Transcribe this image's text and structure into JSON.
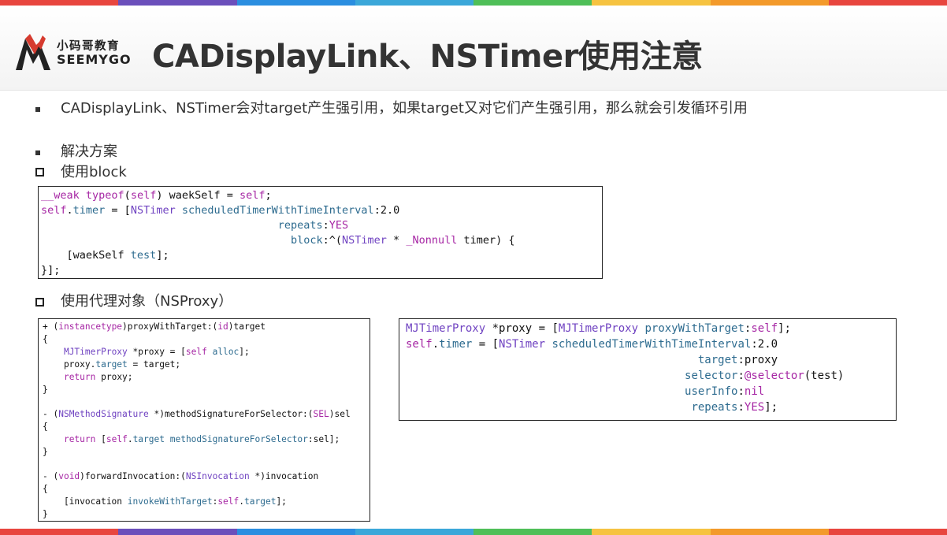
{
  "colors": {
    "stripe": [
      "#e8463f",
      "#6b4fbb",
      "#2b8ee0",
      "#3ba7d9",
      "#4fbf58",
      "#f6c341",
      "#f39a2b",
      "#e8463f"
    ],
    "keyword": "#a626a4",
    "type": "#6f42c1",
    "method": "#2d6b8f"
  },
  "header": {
    "logo_cn": "小码哥教育",
    "logo_en": "SEEMYGO",
    "title": "CADisplayLink、NSTimer使用注意"
  },
  "body": {
    "point1": "CADisplayLink、NSTimer会对target产生强引用，如果target又对它们产生强引用，那么就会引发循环引用",
    "point2": "解决方案",
    "sub1": "使用block",
    "sub2": "使用代理对象（NSProxy）"
  },
  "code_block": [
    [
      {
        "t": "__weak typeof",
        "c": "kw"
      },
      {
        "t": "("
      },
      {
        "t": "self",
        "c": "kw"
      },
      {
        "t": ") waekSelf = "
      },
      {
        "t": "self",
        "c": "kw"
      },
      {
        "t": ";"
      }
    ],
    [
      {
        "t": "self",
        "c": "kw"
      },
      {
        "t": "."
      },
      {
        "t": "timer",
        "c": "mt"
      },
      {
        "t": " = ["
      },
      {
        "t": "NSTimer",
        "c": "ty"
      },
      {
        "t": " "
      },
      {
        "t": "scheduledTimerWithTimeInterval",
        "c": "mt"
      },
      {
        "t": ":2.0"
      }
    ],
    [
      {
        "t": "                                     "
      },
      {
        "t": "repeats",
        "c": "mt"
      },
      {
        "t": ":"
      },
      {
        "t": "YES",
        "c": "kw"
      }
    ],
    [
      {
        "t": "                                       "
      },
      {
        "t": "block",
        "c": "mt"
      },
      {
        "t": ":^("
      },
      {
        "t": "NSTimer",
        "c": "ty"
      },
      {
        "t": " * "
      },
      {
        "t": "_Nonnull",
        "c": "kw"
      },
      {
        "t": " timer) {"
      }
    ],
    [
      {
        "t": "    [waekSelf "
      },
      {
        "t": "test",
        "c": "mt"
      },
      {
        "t": "];"
      }
    ],
    [
      {
        "t": "}];"
      }
    ]
  ],
  "code_proxy": [
    [
      {
        "t": "+ ("
      },
      {
        "t": "instancetype",
        "c": "kw"
      },
      {
        "t": ")proxyWithTarget:("
      },
      {
        "t": "id",
        "c": "kw"
      },
      {
        "t": ")target"
      }
    ],
    [
      {
        "t": "{"
      }
    ],
    [
      {
        "t": "    "
      },
      {
        "t": "MJTimerProxy",
        "c": "ty"
      },
      {
        "t": " *proxy = ["
      },
      {
        "t": "self",
        "c": "kw"
      },
      {
        "t": " "
      },
      {
        "t": "alloc",
        "c": "mt"
      },
      {
        "t": "];"
      }
    ],
    [
      {
        "t": "    proxy."
      },
      {
        "t": "target",
        "c": "mt"
      },
      {
        "t": " = target;"
      }
    ],
    [
      {
        "t": "    "
      },
      {
        "t": "return",
        "c": "kw"
      },
      {
        "t": " proxy;"
      }
    ],
    [
      {
        "t": "}"
      }
    ],
    [
      {
        "t": "- ("
      },
      {
        "t": "NSMethodSignature",
        "c": "ty"
      },
      {
        "t": " *)methodSignatureForSelector:("
      },
      {
        "t": "SEL",
        "c": "kw"
      },
      {
        "t": ")sel"
      }
    ],
    [
      {
        "t": "{"
      }
    ],
    [
      {
        "t": "    "
      },
      {
        "t": "return",
        "c": "kw"
      },
      {
        "t": " ["
      },
      {
        "t": "self",
        "c": "kw"
      },
      {
        "t": "."
      },
      {
        "t": "target",
        "c": "mt"
      },
      {
        "t": " "
      },
      {
        "t": "methodSignatureForSelector",
        "c": "mt"
      },
      {
        "t": ":sel];"
      }
    ],
    [
      {
        "t": "}"
      }
    ],
    [
      {
        "t": "- ("
      },
      {
        "t": "void",
        "c": "kw"
      },
      {
        "t": ")forwardInvocation:("
      },
      {
        "t": "NSInvocation",
        "c": "ty"
      },
      {
        "t": " *)invocation"
      }
    ],
    [
      {
        "t": "{"
      }
    ],
    [
      {
        "t": "    [invocation "
      },
      {
        "t": "invokeWithTarget",
        "c": "mt"
      },
      {
        "t": ":"
      },
      {
        "t": "self",
        "c": "kw"
      },
      {
        "t": "."
      },
      {
        "t": "target",
        "c": "mt"
      },
      {
        "t": "];"
      }
    ],
    [
      {
        "t": "}"
      }
    ]
  ],
  "code_usage": [
    [
      {
        "t": "MJTimerProxy",
        "c": "ty"
      },
      {
        "t": " *proxy = ["
      },
      {
        "t": "MJTimerProxy",
        "c": "ty"
      },
      {
        "t": " "
      },
      {
        "t": "proxyWithTarget",
        "c": "mt"
      },
      {
        "t": ":"
      },
      {
        "t": "self",
        "c": "kw"
      },
      {
        "t": "];"
      }
    ],
    [
      {
        "t": "self",
        "c": "kw"
      },
      {
        "t": "."
      },
      {
        "t": "timer",
        "c": "mt"
      },
      {
        "t": " = ["
      },
      {
        "t": "NSTimer",
        "c": "ty"
      },
      {
        "t": " "
      },
      {
        "t": "scheduledTimerWithTimeInterval",
        "c": "mt"
      },
      {
        "t": ":2.0"
      }
    ],
    [
      {
        "t": "                                            "
      },
      {
        "t": "target",
        "c": "mt"
      },
      {
        "t": ":proxy"
      }
    ],
    [
      {
        "t": "                                          "
      },
      {
        "t": "selector",
        "c": "mt"
      },
      {
        "t": ":"
      },
      {
        "t": "@selector",
        "c": "kw"
      },
      {
        "t": "(test)"
      }
    ],
    [
      {
        "t": "                                          "
      },
      {
        "t": "userInfo",
        "c": "mt"
      },
      {
        "t": ":"
      },
      {
        "t": "nil",
        "c": "kw"
      }
    ],
    [
      {
        "t": "                                           "
      },
      {
        "t": "repeats",
        "c": "mt"
      },
      {
        "t": ":"
      },
      {
        "t": "YES",
        "c": "kw"
      },
      {
        "t": "];"
      }
    ]
  ]
}
